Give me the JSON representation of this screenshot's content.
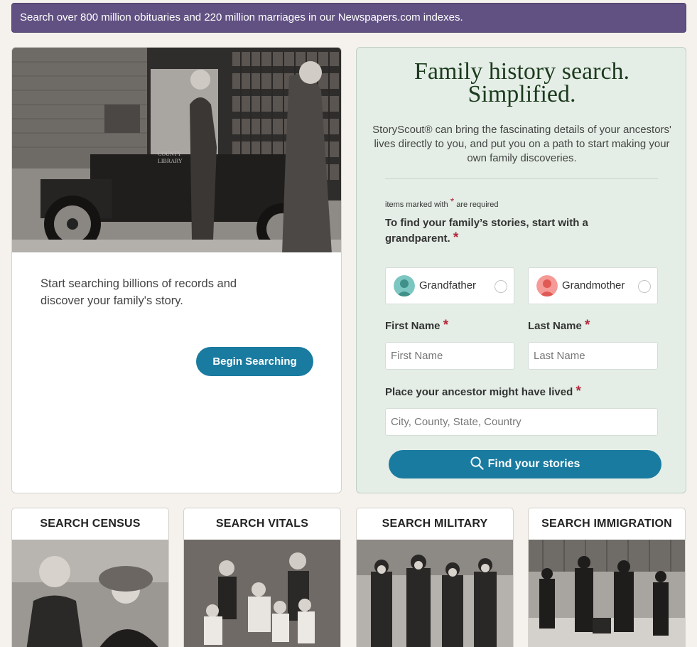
{
  "banner": {
    "text": "Search over 800 million obituaries and 220 million marriages in our Newspapers.com indexes."
  },
  "hero": {
    "photo_sign_line1": "COUNTY",
    "photo_sign_line2": "LIBRARY",
    "text": "Start searching billions of records and discover your family's story.",
    "button_label": "Begin Searching"
  },
  "search_panel": {
    "title_line1": "Family history search.",
    "title_line2": "Simplified.",
    "intro": "StoryScout® can bring the fascinating details of your ancestors' lives directly to you, and put you on a path to start making your own family discoveries.",
    "required_note_before": "items marked with",
    "required_note_star": "*",
    "required_note_after": "are required",
    "grandparent_prompt": "To find your family’s stories, start with a grandparent.",
    "required_star": "*",
    "options": [
      {
        "label": "Grandfather",
        "icon": "man-avatar-icon",
        "color": "#5fb3b0"
      },
      {
        "label": "Grandmother",
        "icon": "woman-avatar-icon",
        "color": "#ef7a7a"
      }
    ],
    "first_name_label": "First Name",
    "first_name_placeholder": "First Name",
    "last_name_label": "Last Name",
    "last_name_placeholder": "Last Name",
    "place_label": "Place your ancestor might have lived",
    "place_placeholder": "City, County, State, Country",
    "find_button_label": "Find your stories",
    "find_button_icon": "search-icon"
  },
  "tiles": [
    {
      "title": "SEARCH CENSUS"
    },
    {
      "title": "SEARCH VITALS"
    },
    {
      "title": "SEARCH MILITARY"
    },
    {
      "title": "SEARCH IMMIGRATION"
    }
  ],
  "colors": {
    "banner_bg": "#615182",
    "accent_button": "#1a7ba0",
    "panel_bg": "#e4eee6",
    "required_star": "#b3263b",
    "title_green": "#1d3b1f"
  }
}
